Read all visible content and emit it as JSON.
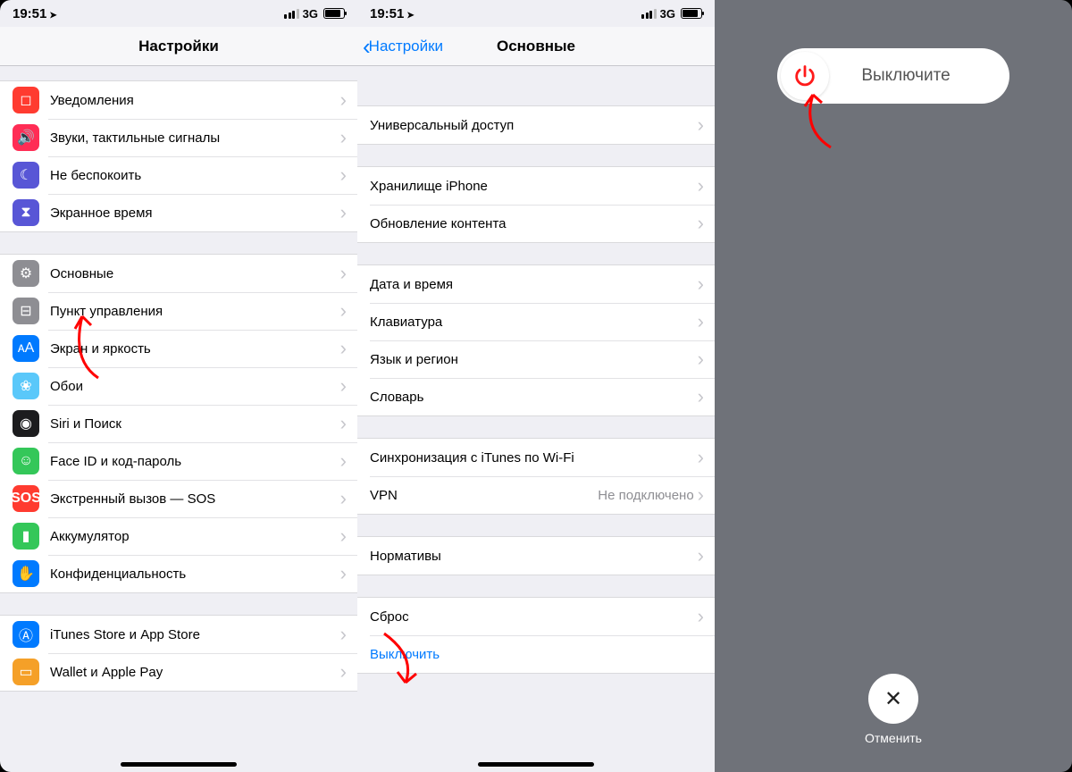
{
  "status": {
    "time": "19:51",
    "carrier": "3G"
  },
  "panel1": {
    "title": "Настройки",
    "group1": [
      {
        "icon": "notifications-icon",
        "color": "ic-red",
        "glyph": "◻",
        "label": "Уведомления"
      },
      {
        "icon": "sounds-icon",
        "color": "ic-pink",
        "glyph": "🔊",
        "label": "Звуки, тактильные сигналы"
      },
      {
        "icon": "dnd-icon",
        "color": "ic-purple",
        "glyph": "☾",
        "label": "Не беспокоить"
      },
      {
        "icon": "screentime-icon",
        "color": "ic-hourglass",
        "glyph": "⧗",
        "label": "Экранное время"
      }
    ],
    "group2": [
      {
        "icon": "general-icon",
        "color": "ic-gray",
        "glyph": "⚙",
        "label": "Основные"
      },
      {
        "icon": "control-center-icon",
        "color": "ic-gray",
        "glyph": "⊟",
        "label": "Пункт управления"
      },
      {
        "icon": "display-icon",
        "color": "ic-blue",
        "glyph": "ᴀA",
        "label": "Экран и яркость"
      },
      {
        "icon": "wallpaper-icon",
        "color": "ic-cyan",
        "glyph": "❀",
        "label": "Обои"
      },
      {
        "icon": "siri-icon",
        "color": "ic-black",
        "glyph": "◉",
        "label": "Siri и Поиск"
      },
      {
        "icon": "faceid-icon",
        "color": "ic-green",
        "glyph": "☺",
        "label": "Face ID и код-пароль"
      },
      {
        "icon": "sos-icon",
        "color": "ic-sos",
        "glyph": "SOS",
        "label": "Экстренный вызов — SOS"
      },
      {
        "icon": "battery-icon",
        "color": "ic-green",
        "glyph": "▮",
        "label": "Аккумулятор"
      },
      {
        "icon": "privacy-icon",
        "color": "ic-blue",
        "glyph": "✋",
        "label": "Конфиденциальность"
      }
    ],
    "group3": [
      {
        "icon": "itunes-icon",
        "color": "ic-blue",
        "glyph": "Ⓐ",
        "label": "iTunes Store и App Store"
      },
      {
        "icon": "wallet-icon",
        "color": "ic-orange",
        "glyph": "▭",
        "label": "Wallet и Apple Pay"
      }
    ]
  },
  "panel2": {
    "back": "Настройки",
    "title": "Основные",
    "g1": [
      {
        "label": "Универсальный доступ"
      }
    ],
    "g2": [
      {
        "label": "Хранилище iPhone"
      },
      {
        "label": "Обновление контента"
      }
    ],
    "g3": [
      {
        "label": "Дата и время"
      },
      {
        "label": "Клавиатура"
      },
      {
        "label": "Язык и регион"
      },
      {
        "label": "Словарь"
      }
    ],
    "g4": [
      {
        "label": "Синхронизация с iTunes по Wi-Fi"
      },
      {
        "label": "VPN",
        "value": "Не подключено"
      }
    ],
    "g5": [
      {
        "label": "Нормативы"
      }
    ],
    "g6": [
      {
        "label": "Сброс"
      },
      {
        "label": "Выключить",
        "link": true,
        "nochev": true
      }
    ]
  },
  "panel3": {
    "slide_label": "Выключите",
    "cancel_label": "Отменить"
  }
}
